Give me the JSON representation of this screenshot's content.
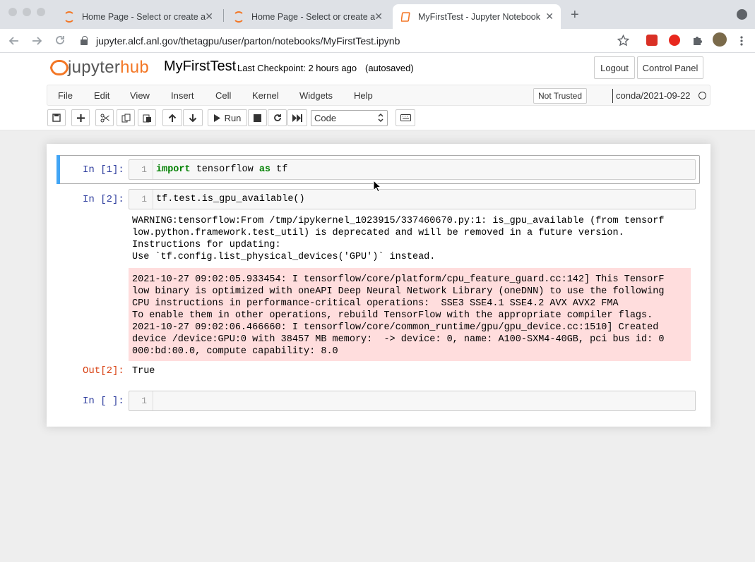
{
  "browser": {
    "tabs": [
      {
        "title": "Home Page - Select or create a",
        "active": false
      },
      {
        "title": "Home Page - Select or create a",
        "active": false
      },
      {
        "title": "MyFirstTest - Jupyter Notebook",
        "active": true
      }
    ],
    "url": "jupyter.alcf.anl.gov/thetagpu/user/parton/notebooks/MyFirstTest.ipynb",
    "new_tab_glyph": "+",
    "close_glyph": "✕"
  },
  "header": {
    "logo_jupyter": "jupyter",
    "logo_hub": "hub",
    "notebook_name": "MyFirstTest",
    "checkpoint": "Last Checkpoint: 2 hours ago",
    "autosave_status": "(autosaved)",
    "logout_label": "Logout",
    "control_panel_label": "Control Panel"
  },
  "menubar": {
    "items": [
      "File",
      "Edit",
      "View",
      "Insert",
      "Cell",
      "Kernel",
      "Widgets",
      "Help"
    ],
    "trust_label": "Not Trusted",
    "kernel_name": "conda/2021-09-22"
  },
  "toolbar": {
    "run_label": "Run",
    "cell_type": "Code"
  },
  "cells": [
    {
      "prompt": "In [1]:",
      "line_no": "1",
      "code_kw1": "import",
      "code_mid": " tensorflow ",
      "code_kw2": "as",
      "code_end": " tf"
    },
    {
      "prompt": "In [2]:",
      "line_no": "1",
      "code": "tf.test.is_gpu_available()",
      "warning_lines": [
        "WARNING:tensorflow:From /tmp/ipykernel_1023915/337460670.py:1: is_gpu_available (from tensorf",
        "low.python.framework.test_util) is deprecated and will be removed in a future version.",
        "Instructions for updating:",
        "Use `tf.config.list_physical_devices('GPU')` instead."
      ],
      "stderr_lines": [
        "2021-10-27 09:02:05.933454: I tensorflow/core/platform/cpu_feature_guard.cc:142] This TensorF",
        "low binary is optimized with oneAPI Deep Neural Network Library (oneDNN) to use the following",
        "CPU instructions in performance-critical operations:  SSE3 SSE4.1 SSE4.2 AVX AVX2 FMA",
        "To enable them in other operations, rebuild TensorFlow with the appropriate compiler flags.",
        "2021-10-27 09:02:06.466660: I tensorflow/core/common_runtime/gpu/gpu_device.cc:1510] Created",
        "device /device:GPU:0 with 38457 MB memory:  -> device: 0, name: A100-SXM4-40GB, pci bus id: 0",
        "000:bd:00.0, compute capability: 8.0"
      ],
      "out_prompt": "Out[2]:",
      "result": "True"
    },
    {
      "prompt": "In [ ]:",
      "line_no": "1",
      "code": ""
    }
  ],
  "colors": {
    "jupyter_orange": "#f37726",
    "selected_cell_bar": "#42a5f5",
    "stderr_bg": "#ffdddd",
    "prompt_in": "#303f9f",
    "prompt_out": "#d84315"
  }
}
